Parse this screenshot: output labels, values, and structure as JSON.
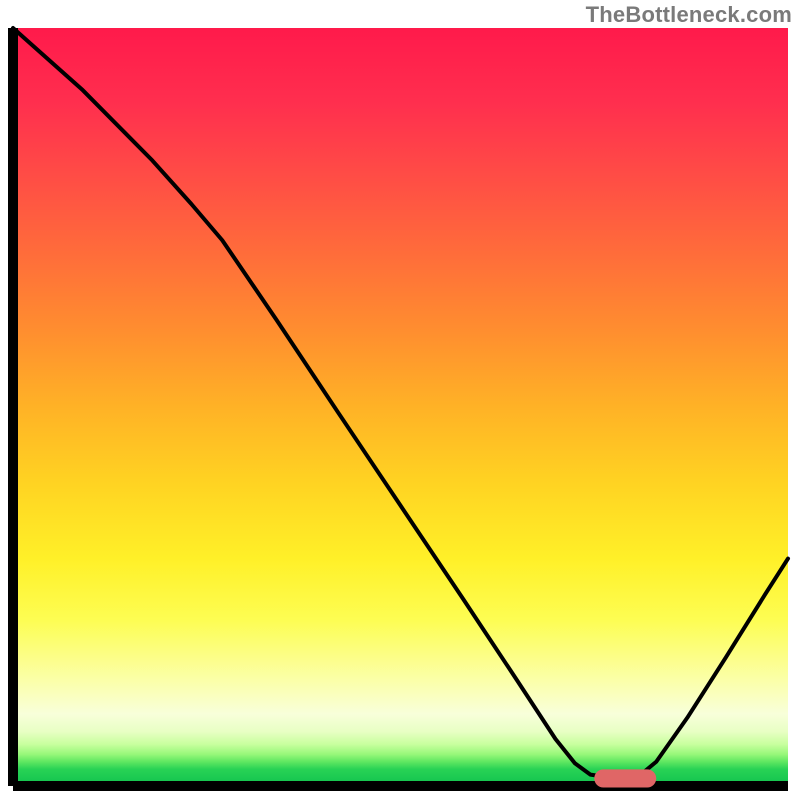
{
  "watermark": "TheBottleneck.com",
  "chart_data": {
    "type": "line",
    "title": "",
    "xlabel": "",
    "ylabel": "",
    "xlim": [
      0,
      100
    ],
    "ylim": [
      0,
      100
    ],
    "grid": false,
    "legend": false,
    "background_gradient_stops": [
      {
        "offset": 0.0,
        "color": "#ff1a4b"
      },
      {
        "offset": 0.1,
        "color": "#ff2f4e"
      },
      {
        "offset": 0.2,
        "color": "#ff4e45"
      },
      {
        "offset": 0.3,
        "color": "#ff6d3a"
      },
      {
        "offset": 0.4,
        "color": "#ff8e2f"
      },
      {
        "offset": 0.5,
        "color": "#ffb226"
      },
      {
        "offset": 0.6,
        "color": "#ffd322"
      },
      {
        "offset": 0.7,
        "color": "#fff028"
      },
      {
        "offset": 0.78,
        "color": "#fdfd52"
      },
      {
        "offset": 0.86,
        "color": "#fbffa8"
      },
      {
        "offset": 0.905,
        "color": "#f8ffda"
      },
      {
        "offset": 0.928,
        "color": "#e8ffc4"
      },
      {
        "offset": 0.945,
        "color": "#c8ff9e"
      },
      {
        "offset": 0.958,
        "color": "#98f87a"
      },
      {
        "offset": 0.968,
        "color": "#5fe761"
      },
      {
        "offset": 0.978,
        "color": "#28d255"
      },
      {
        "offset": 1.0,
        "color": "#10c24e"
      }
    ],
    "series": [
      {
        "name": "bottleneck-curve",
        "stroke": "#000000",
        "stroke_width": 4,
        "points": [
          {
            "x": 0.0,
            "y": 100.0
          },
          {
            "x": 9.0,
            "y": 91.8
          },
          {
            "x": 18.0,
            "y": 82.5
          },
          {
            "x": 23.0,
            "y": 76.8
          },
          {
            "x": 27.0,
            "y": 72.0
          },
          {
            "x": 34.0,
            "y": 61.5
          },
          {
            "x": 42.0,
            "y": 49.2
          },
          {
            "x": 50.0,
            "y": 37.0
          },
          {
            "x": 58.0,
            "y": 24.8
          },
          {
            "x": 65.0,
            "y": 14.0
          },
          {
            "x": 70.0,
            "y": 6.2
          },
          {
            "x": 72.5,
            "y": 3.0
          },
          {
            "x": 74.5,
            "y": 1.5
          },
          {
            "x": 76.5,
            "y": 1.2
          },
          {
            "x": 79.0,
            "y": 1.2
          },
          {
            "x": 81.0,
            "y": 1.5
          },
          {
            "x": 83.0,
            "y": 3.2
          },
          {
            "x": 87.0,
            "y": 9.0
          },
          {
            "x": 92.0,
            "y": 17.0
          },
          {
            "x": 97.0,
            "y": 25.2
          },
          {
            "x": 100.0,
            "y": 30.0
          }
        ]
      }
    ],
    "marker": {
      "name": "optimal-marker",
      "color": "#e06666",
      "x_start": 75.0,
      "x_end": 83.0,
      "y": 1.0,
      "thickness": 2.4
    }
  }
}
